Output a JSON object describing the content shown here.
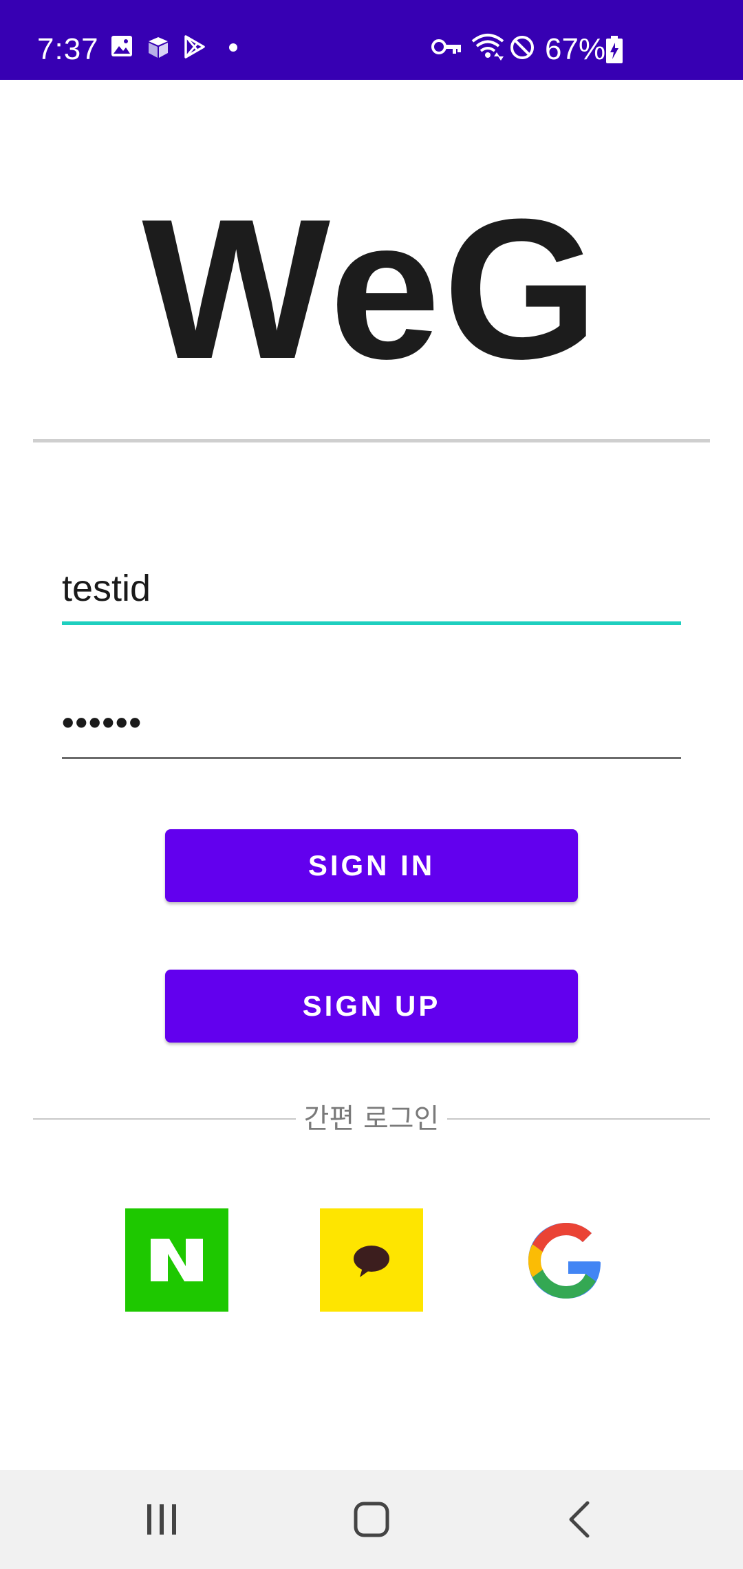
{
  "status_bar": {
    "time": "7:37",
    "battery_percent": "67%",
    "background_color": "#3700b3",
    "icons": [
      "gallery-icon",
      "box-icon",
      "play-store-icon",
      "notification-dot-icon",
      "vpn-key-icon",
      "wifi-icon",
      "do-not-disturb-icon",
      "battery-charging-icon"
    ]
  },
  "logo": {
    "text": "WeG"
  },
  "login_form": {
    "id_value": "testid",
    "password_value": "••••••",
    "accent_color": "#1ecfbf"
  },
  "buttons": {
    "sign_in": "SIGN IN",
    "sign_up": "SIGN UP",
    "color": "#6200ee"
  },
  "easy_login": {
    "label": "간편 로그인",
    "providers": [
      {
        "name": "naver",
        "icon": "naver-icon",
        "color": "#1ec800"
      },
      {
        "name": "kakao",
        "icon": "kakao-icon",
        "color": "#fee500"
      },
      {
        "name": "google",
        "icon": "google-icon",
        "color": "#4285f4"
      }
    ]
  },
  "nav_bar": {
    "icons": [
      "recent-apps-icon",
      "home-icon",
      "back-icon"
    ]
  }
}
